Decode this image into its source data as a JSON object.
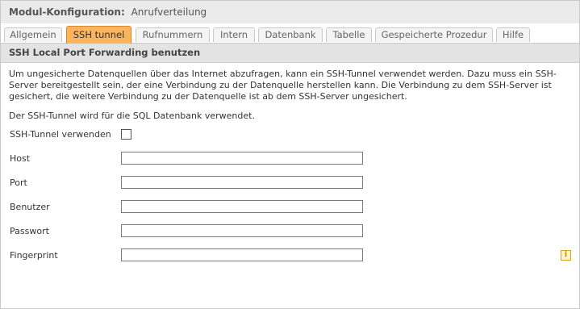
{
  "header": {
    "label": "Modul-Konfiguration:",
    "value": "Anrufverteilung"
  },
  "tabs": [
    {
      "label": "Allgemein",
      "active": false
    },
    {
      "label": "SSH tunnel",
      "active": true
    },
    {
      "label": "Rufnummern",
      "active": false
    },
    {
      "label": "Intern",
      "active": false
    },
    {
      "label": "Datenbank",
      "active": false
    },
    {
      "label": "Tabelle",
      "active": false
    },
    {
      "label": "Gespeicherte Prozedur",
      "active": false
    },
    {
      "label": "Hilfe",
      "active": false
    }
  ],
  "section": {
    "title": "SSH Local Port Forwarding benutzen",
    "description": "Um ungesicherte Datenquellen über das Internet abzufragen, kann ein SSH-Tunnel verwendet werden. Dazu muss ein SSH-Server bereitgestellt sein, der eine Verbindung zu der Datenquelle herstellen kann. Die Verbindung zu dem SSH-Server ist gesichert, die weitere Verbindung zu der Datenquelle ist ab dem SSH-Server ungesichert.",
    "note": "Der SSH-Tunnel wird für die SQL Datenbank verwendet."
  },
  "form": {
    "use_tunnel_label": "SSH-Tunnel verwenden",
    "use_tunnel_checked": false,
    "fields": [
      {
        "label": "Host",
        "value": ""
      },
      {
        "label": "Port",
        "value": ""
      },
      {
        "label": "Benutzer",
        "value": ""
      },
      {
        "label": "Passwort",
        "value": ""
      },
      {
        "label": "Fingerprint",
        "value": ""
      }
    ]
  },
  "icons": {
    "info": "info-icon"
  },
  "colors": {
    "active_tab": "#fdb45d",
    "header_bg": "#ebebeb",
    "section_bg": "#e3e3e3"
  }
}
